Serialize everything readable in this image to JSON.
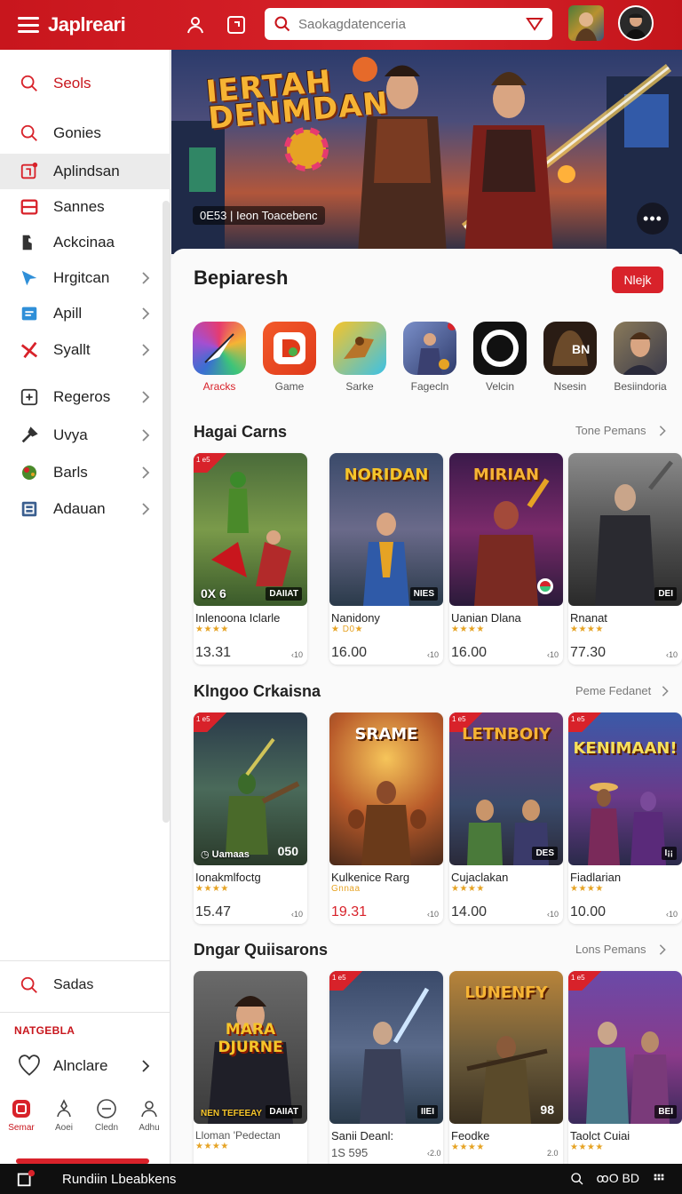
{
  "header": {
    "brand": "Japlreari",
    "search_placeholder": "Saokagdatenceria"
  },
  "sidebar": {
    "items": [
      {
        "label": "Seols",
        "icon": "search-icon",
        "accent": true
      },
      {
        "label": "Gonies",
        "icon": "search-icon"
      },
      {
        "label": "Aplindsan",
        "icon": "app-badge-icon",
        "active": true
      },
      {
        "label": "Sannes",
        "icon": "grid-icon"
      },
      {
        "label": "Ackcinaa",
        "icon": "puzzle-icon"
      },
      {
        "label": "Hrgitcan",
        "icon": "arrow-icon",
        "chevron": true
      },
      {
        "label": "Apill",
        "icon": "doc-icon",
        "chevron": true
      },
      {
        "label": "Syallt",
        "icon": "cross-icon",
        "chevron": true
      },
      {
        "label": "Regeros",
        "icon": "plus-box-icon",
        "chevron": true
      },
      {
        "label": "Uvya",
        "icon": "tools-icon",
        "chevron": true
      },
      {
        "label": "Barls",
        "icon": "leaf-icon",
        "chevron": true
      },
      {
        "label": "Adauan",
        "icon": "box-icon",
        "chevron": true
      }
    ],
    "bottom_search": "Sadas",
    "section_label": "NATGEBLA",
    "favorite_item": "Alnclare",
    "bottom_nav": [
      {
        "label": "Semar",
        "icon": "home-icon",
        "active": true
      },
      {
        "label": "Aoei",
        "icon": "profile-icon"
      },
      {
        "label": "Cledn",
        "icon": "circle-icon"
      },
      {
        "label": "Adhu",
        "icon": "user-icon"
      }
    ]
  },
  "hero": {
    "title_line1": "IERTAH",
    "title_line2": "DENMDAN",
    "caption": "0E53 | Ieon Toacebenc"
  },
  "main": {
    "title": "Bepiaresh",
    "button": "Nlejk",
    "apps": [
      {
        "label": "Aracks",
        "accent": true
      },
      {
        "label": "Game"
      },
      {
        "label": "Sarke"
      },
      {
        "label": "Fagecln"
      },
      {
        "label": "Velcin"
      },
      {
        "label": "Nsesin"
      },
      {
        "label": "Besiindoria"
      }
    ],
    "sections": [
      {
        "title": "Hagai Carns",
        "link": "Tone Pemans",
        "cards": [
          {
            "title": "Inlenoona Iclarle",
            "stars": "★★★★",
            "price": "13.31",
            "tag": "‹10",
            "bl": "0X 6",
            "br": "DAIIAT",
            "art_text": ""
          },
          {
            "title": "Nanidony",
            "stars": "★ D0★",
            "price": "16.00",
            "tag": "‹10",
            "bl": "",
            "br": "NIES",
            "art_text": "NORIDAN"
          },
          {
            "title": "Uanian Dlana",
            "stars": "★★★★",
            "price": "16.00",
            "tag": "‹10",
            "bl": "",
            "br": "",
            "art_text": "MIRIAN"
          },
          {
            "title": "Rnanat",
            "stars": "★★★★",
            "price": "77.30",
            "tag": "‹10",
            "bl": "",
            "br": "DEI",
            "art_text": ""
          }
        ]
      },
      {
        "title": "Klngoo Crkaisna",
        "link": "Peme Fedanet",
        "cards": [
          {
            "title": "Ionakmlfoctg",
            "stars": "★★★★",
            "price": "15.47",
            "tag": "‹10",
            "bl": "Uamaas",
            "br": "050",
            "art_text": ""
          },
          {
            "title": "Kulkenice Rarg",
            "stars": "Gnnaa",
            "price": "19.31",
            "tag": "‹10",
            "bl": "",
            "br": "",
            "art_text": "SRAME",
            "red_price": true
          },
          {
            "title": "Cujaclakan",
            "stars": "★★★★",
            "price": "14.00",
            "tag": "‹10",
            "bl": "",
            "br": "DES",
            "art_text": "LETNBOIY"
          },
          {
            "title": "Fiadlarian",
            "stars": "★★★★",
            "price": "10.00",
            "tag": "‹10",
            "bl": "",
            "br": "I¡¡",
            "art_text": "KENIMAAN!"
          }
        ]
      },
      {
        "title": "Dngar Quiisarons",
        "link": "Lons Pemans",
        "cards": [
          {
            "title": "Lloman 'Pedectan",
            "stars": "★★★★",
            "price": "",
            "tag": "",
            "bl": "NEN TEFEEAY",
            "br": "DAIIAT",
            "art_text": "MARA DJURNE"
          },
          {
            "title": "Sanii Deanl:",
            "stars": "",
            "price": "1S 595",
            "tag": "‹2.0",
            "bl": "",
            "br": "IIEI",
            "art_text": ""
          },
          {
            "title": "Feodke",
            "stars": "★★★★",
            "price": "",
            "tag": "2.0",
            "bl": "",
            "br": "98",
            "art_text": "LUNENFY"
          },
          {
            "title": "Taolct Cuiai",
            "stars": "★★★★",
            "price": "",
            "tag": "",
            "bl": "",
            "br": "BEI",
            "art_text": ""
          }
        ]
      }
    ]
  },
  "sysbar": {
    "status": "Rundiin Lbeabkens",
    "right": "ꚙO BD"
  },
  "colors": {
    "brand_red": "#d8222a",
    "sidebar_bg": "#ffffff",
    "page_bg": "#f1f1f3"
  }
}
